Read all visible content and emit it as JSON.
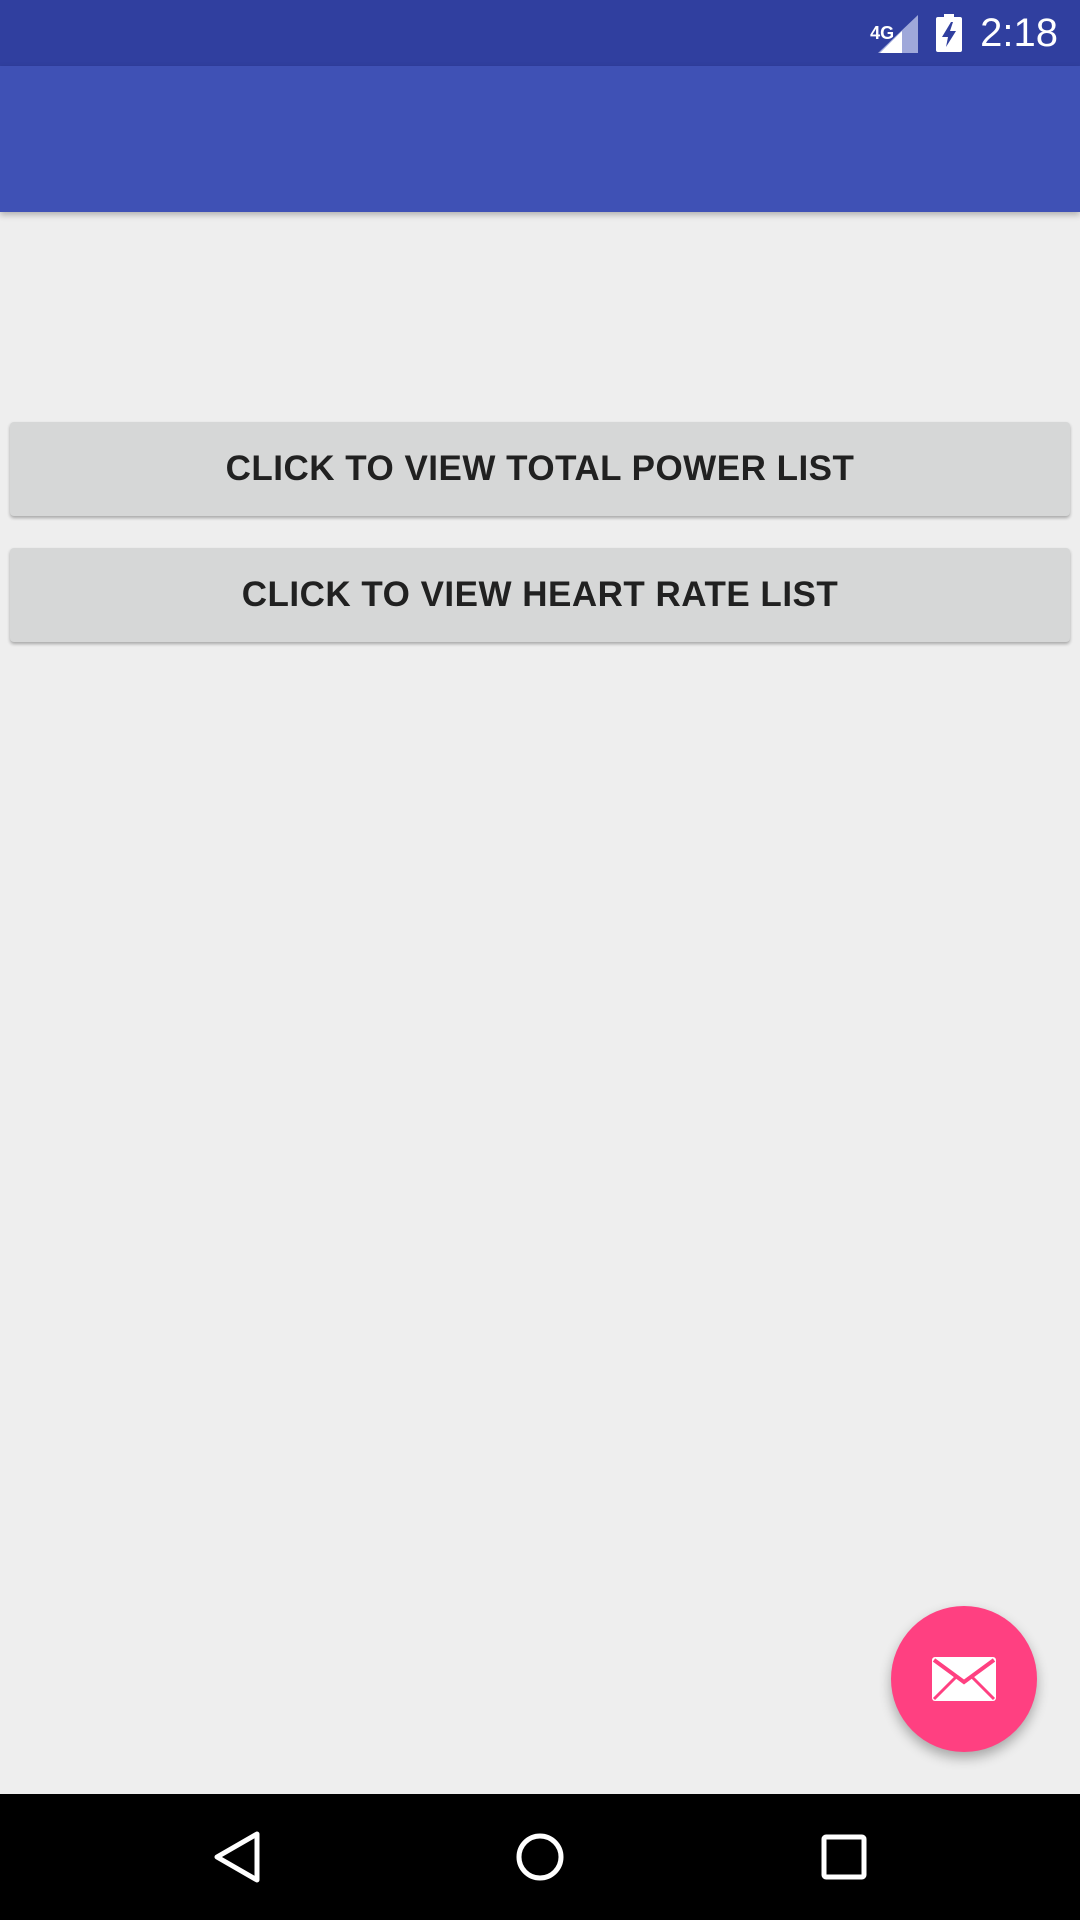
{
  "status_bar": {
    "network": "4G",
    "time": "2:18"
  },
  "main": {
    "total_power_button": "CLICK TO VIEW TOTAL POWER LIST",
    "heart_rate_button": "CLICK TO VIEW HEART RATE LIST"
  },
  "fab": {
    "icon": "email-icon",
    "color": "#ff4081"
  },
  "nav_bar": {
    "back_icon": "back-icon",
    "home_icon": "home-icon",
    "recents_icon": "recents-icon"
  },
  "colors": {
    "status_bar": "#303f9f",
    "app_bar": "#3f51b5",
    "background": "#eeeeee",
    "button": "#d6d7d7"
  }
}
